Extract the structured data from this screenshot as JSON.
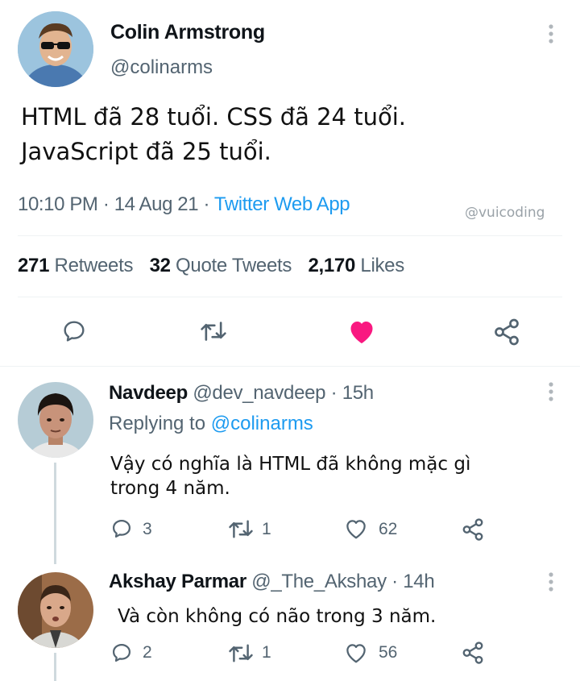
{
  "main_tweet": {
    "author_name": "Colin Armstrong",
    "author_handle": "@colinarms",
    "text_line1": "HTML đã 28 tuổi. CSS đã 24 tuổi.",
    "text_line2": "JavaScript đã 25 tuổi.",
    "time": "10:10 PM",
    "sep1": "·",
    "date": "14 Aug 21",
    "sep2": "·",
    "source": "Twitter Web App",
    "watermark": "@vuicoding",
    "retweets_count": "271",
    "retweets_label": "Retweets",
    "quotes_count": "32",
    "quotes_label": "Quote Tweets",
    "likes_count": "2,170",
    "likes_label": "Likes",
    "like_color": "#f91880"
  },
  "replies": [
    {
      "author_name": "Navdeep",
      "author_handle": "@dev_navdeep",
      "sep": "·",
      "age": "15h",
      "replying_prefix": "Replying to",
      "replying_handle": "@colinarms",
      "text_line1": "Vậy có nghĩa là HTML đã không mặc gì",
      "text_line2": "trong 4 năm.",
      "reply_count": "3",
      "retweet_count": "1",
      "like_count": "62"
    },
    {
      "author_name": "Akshay Parmar",
      "author_handle": "@_The_Akshay",
      "sep": "·",
      "age": "14h",
      "text_line1": "Và còn không có não trong 3 năm.",
      "reply_count": "2",
      "retweet_count": "1",
      "like_count": "56"
    }
  ]
}
